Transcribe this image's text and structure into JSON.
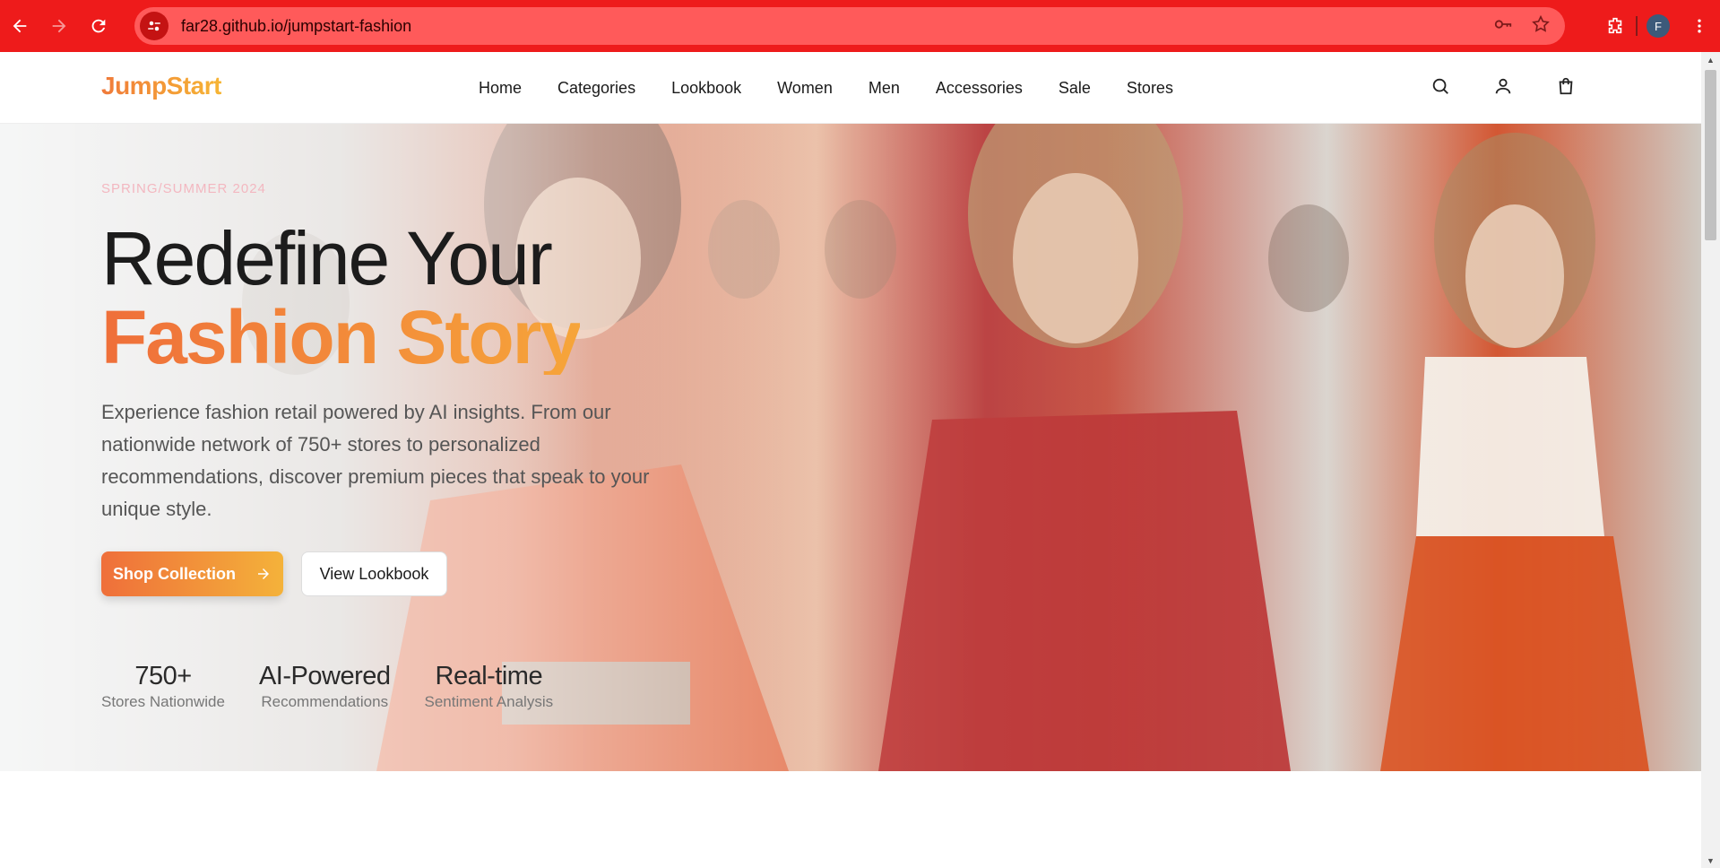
{
  "browser": {
    "url": "far28.github.io/jumpstart-fashion",
    "avatar_letter": "F"
  },
  "header": {
    "logo": "JumpStart",
    "nav": [
      "Home",
      "Categories",
      "Lookbook",
      "Women",
      "Men",
      "Accessories",
      "Sale",
      "Stores"
    ]
  },
  "hero": {
    "season": "SPRING/SUMMER 2024",
    "title_line1": "Redefine Your",
    "title_line2": "Fashion Story",
    "description": "Experience fashion retail powered by AI insights. From our nationwide network of 750+ stores to personalized recommendations, discover premium pieces that speak to your unique style.",
    "primary_button": "Shop Collection",
    "secondary_button": "View Lookbook",
    "stats": [
      {
        "value": "750+",
        "label": "Stores Nationwide"
      },
      {
        "value": "AI-Powered",
        "label": "Recommendations"
      },
      {
        "value": "Real-time",
        "label": "Sentiment Analysis"
      }
    ]
  },
  "colors": {
    "chrome": "#ee1b1b",
    "accent_start": "#ef6f3a",
    "accent_end": "#f4b23a"
  }
}
